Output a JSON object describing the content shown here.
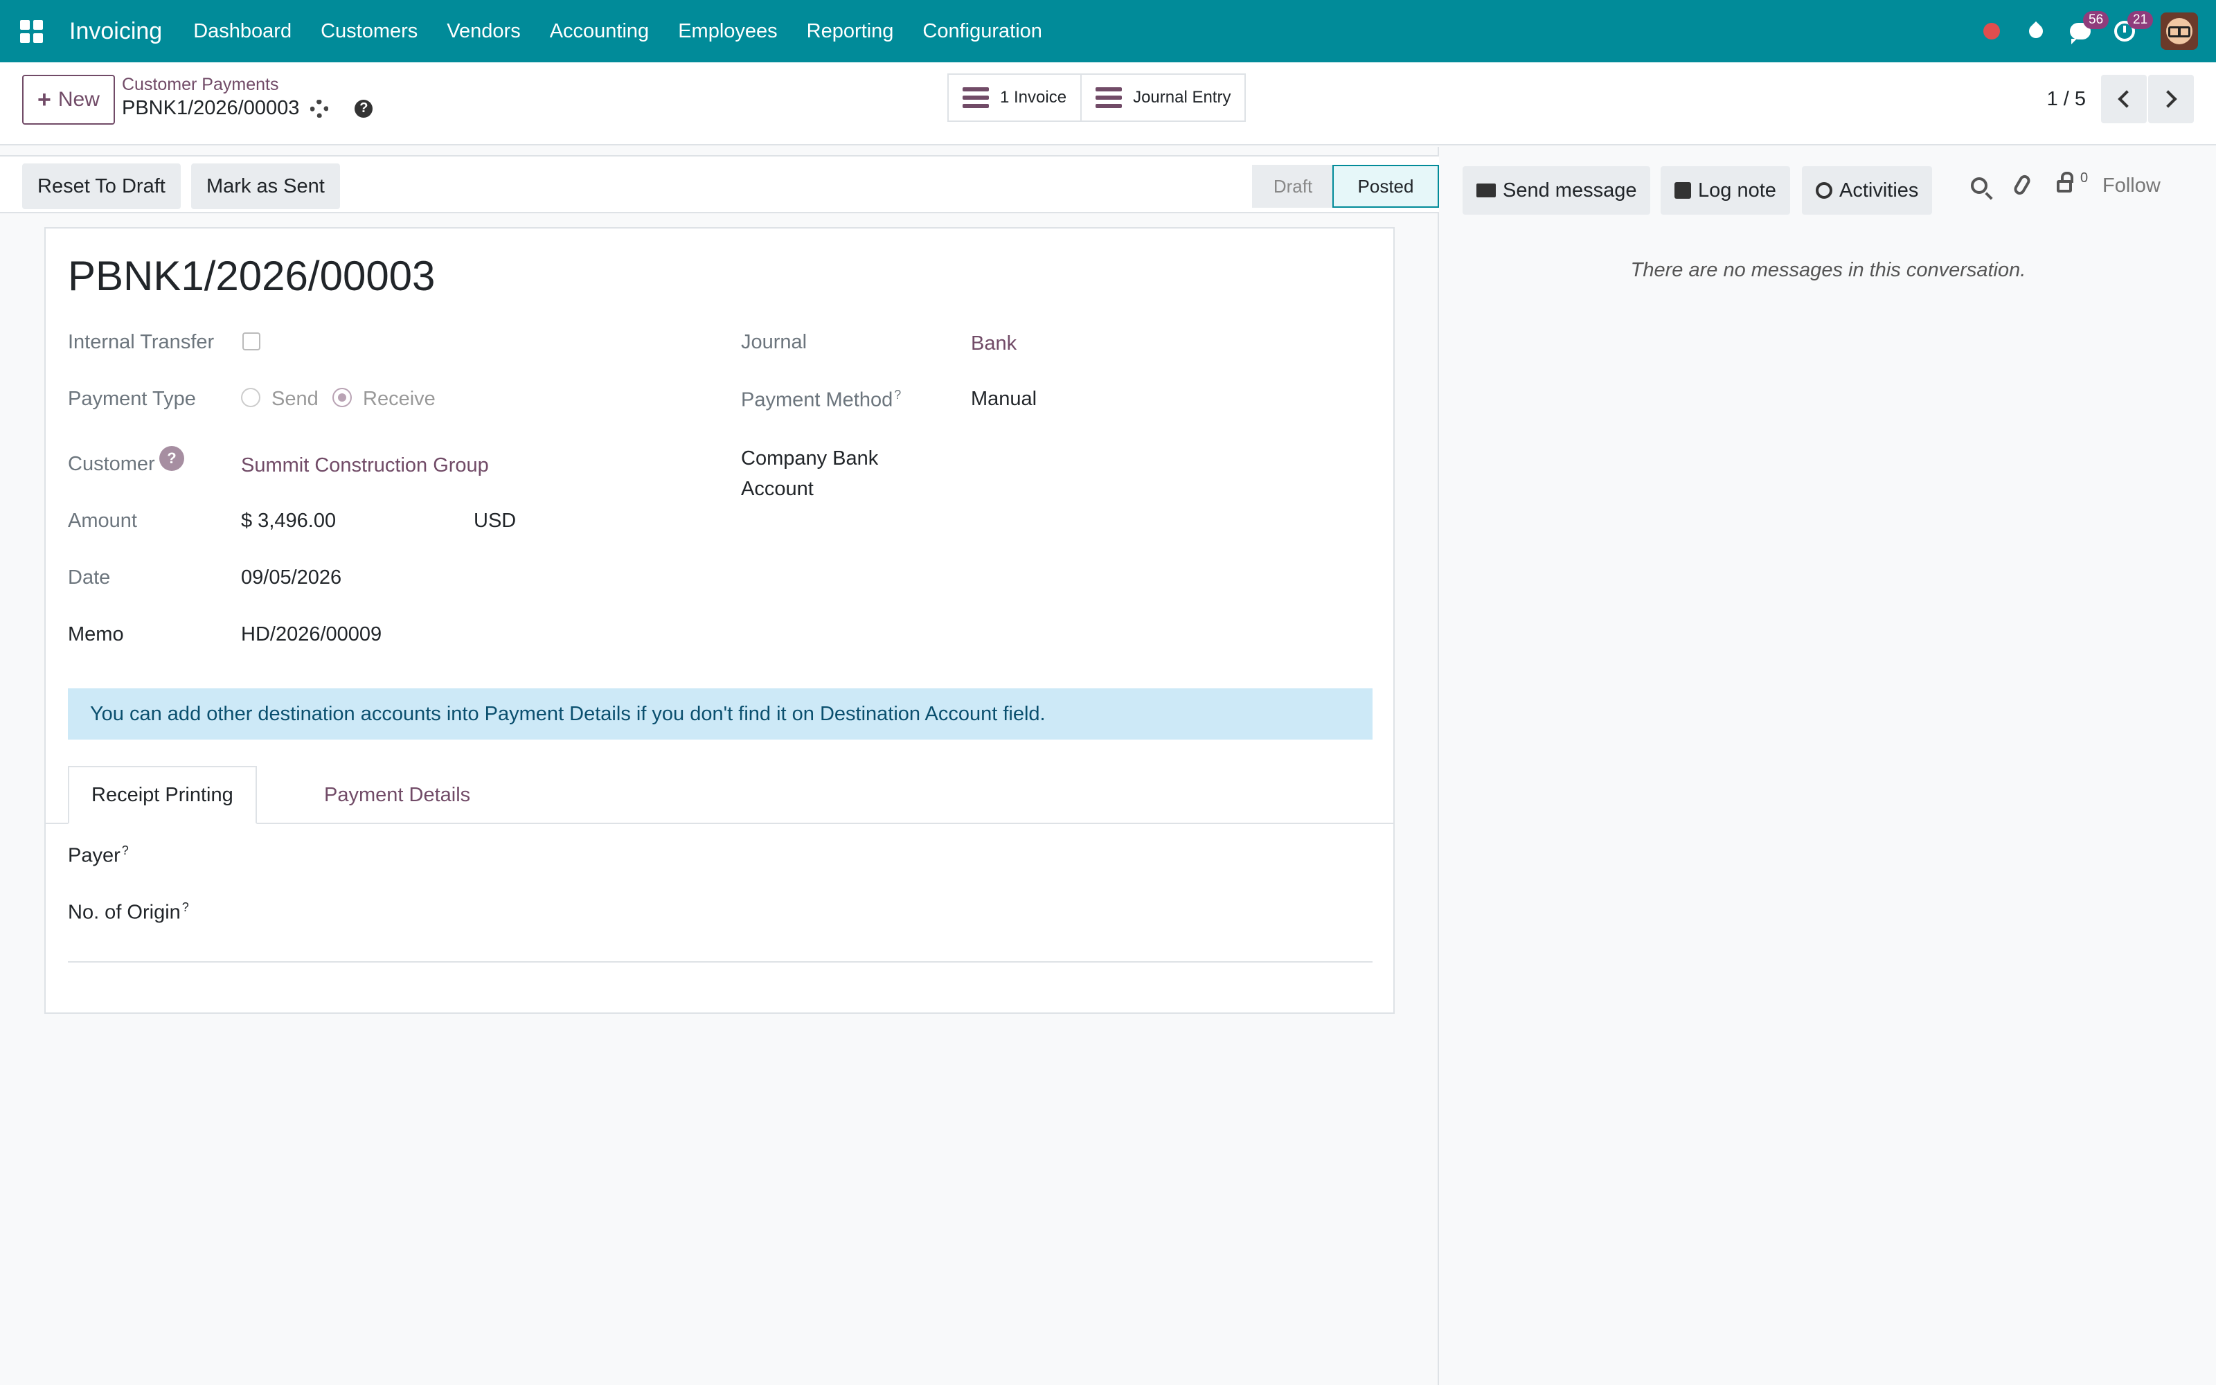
{
  "app": {
    "title": "Invoicing",
    "menu": [
      "Dashboard",
      "Customers",
      "Vendors",
      "Accounting",
      "Employees",
      "Reporting",
      "Configuration"
    ],
    "badges": {
      "messages": "56",
      "activities": "21"
    }
  },
  "breadcrumb": {
    "parent": "Customer Payments",
    "current": "PBNK1/2026/00003"
  },
  "toolbar": {
    "new_label": "New",
    "help_glyph": "?"
  },
  "smart_buttons": {
    "invoice": "1 Invoice",
    "journal_entry": "Journal Entry"
  },
  "pager": {
    "value": "1 / 5"
  },
  "statusbar": {
    "reset_to_draft": "Reset To Draft",
    "mark_as_sent": "Mark as Sent",
    "stages": [
      "Draft",
      "Posted"
    ],
    "current_stage": "Posted"
  },
  "form": {
    "title": "PBNK1/2026/00003",
    "internal_transfer_label": "Internal Transfer",
    "internal_transfer_checked": false,
    "payment_type_label": "Payment Type",
    "payment_type_options": [
      "Send",
      "Receive"
    ],
    "payment_type_selected": "Receive",
    "customer_label": "Customer",
    "customer_tip": "?",
    "customer_value": "Summit Construction Group",
    "amount_label": "Amount",
    "amount_value": "$ 3,496.00",
    "currency": "USD",
    "date_label": "Date",
    "date_value": "09/05/2026",
    "memo_label": "Memo",
    "memo_value": "HD/2026/00009",
    "journal_label": "Journal",
    "journal_value": "Bank",
    "payment_method_label": "Payment Method",
    "payment_method_value": "Manual",
    "company_bank_label_1": "Company Bank",
    "company_bank_label_2": "Account",
    "tooltip_mark": "?"
  },
  "alert": "You can add other destination accounts into Payment Details if you don't find it on Destination Account field.",
  "tabs": {
    "receipt_printing": "Receipt Printing",
    "payment_details": "Payment Details",
    "active": "Receipt Printing"
  },
  "receipt": {
    "payer_label": "Payer",
    "origin_label": "No. of Origin"
  },
  "chatter": {
    "send_message": "Send message",
    "log_note": "Log note",
    "activities": "Activities",
    "followers_count": "0",
    "follow": "Follow",
    "empty": "There are no messages in this conversation."
  },
  "colors": {
    "navbar": "#018b99",
    "brand": "#714b67",
    "alert_bg": "#cde9f7",
    "record_dot": "#e04e4e"
  },
  "icons": [
    "apps-grid-icon",
    "record-icon",
    "drop-icon",
    "chat-icon",
    "clock-icon",
    "gear-icon",
    "help-icon",
    "list-icon",
    "chevron-left-icon",
    "chevron-right-icon",
    "envelope-icon",
    "note-icon",
    "activity-clock-icon",
    "search-icon",
    "paperclip-icon",
    "lock-icon"
  ]
}
